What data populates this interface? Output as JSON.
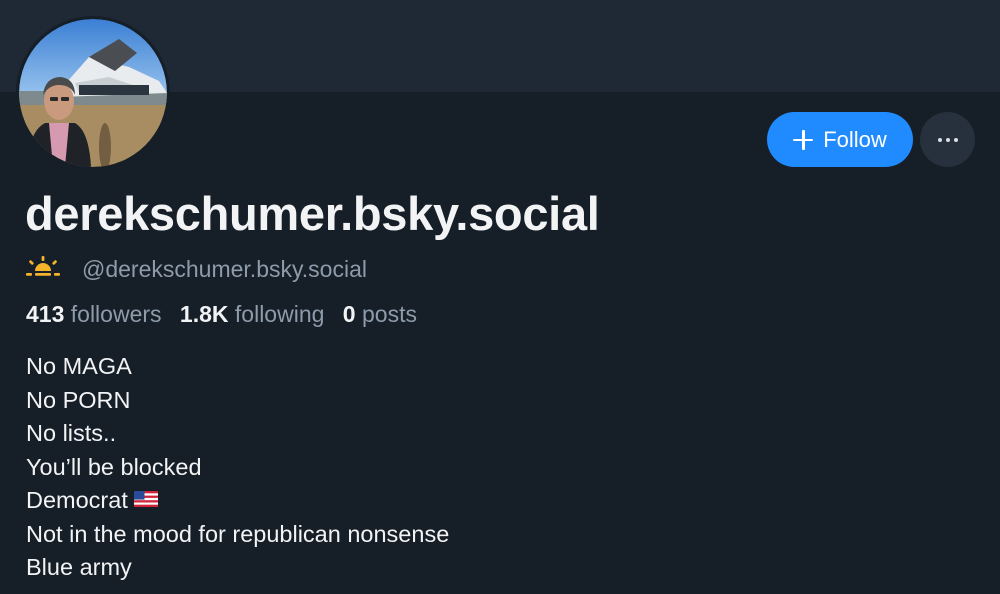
{
  "profile": {
    "display_name": "derekschumer.bsky.social",
    "handle": "@derekschumer.bsky.social",
    "handle_icon": "sunrise-icon",
    "avatar_icon": "profile-photo",
    "follow_label": "Follow",
    "follow_icon": "plus-icon",
    "more_icon": "ellipsis-icon"
  },
  "stats": {
    "followers_count": "413",
    "followers_label": "followers",
    "following_count": "1.8K",
    "following_label": "following",
    "posts_count": "0",
    "posts_label": "posts"
  },
  "bio": {
    "lines": [
      "No MAGA",
      "No PORN",
      "No lists..",
      "You’ll be blocked",
      "Democrat",
      "Not in the mood for republican nonsense",
      "Blue army"
    ],
    "flag_icon": "us-flag-icon"
  },
  "colors": {
    "background": "#161e27",
    "banner": "#1e2935",
    "accent": "#208bfe",
    "muted_text": "#8d9bab",
    "text": "#f1f3f5"
  }
}
